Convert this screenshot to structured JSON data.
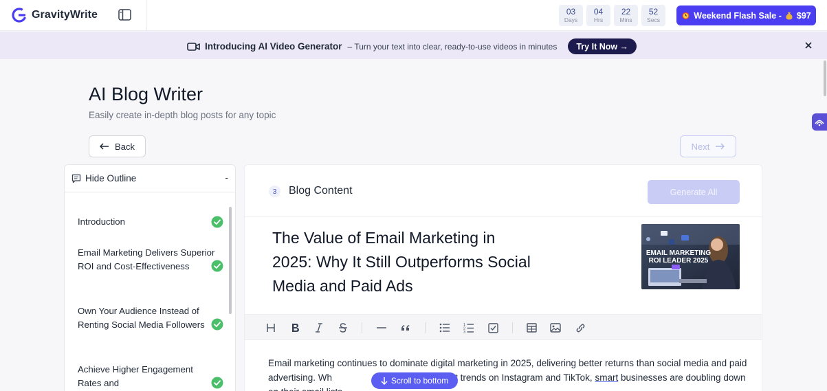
{
  "app": {
    "name": "GravityWrite"
  },
  "countdown": [
    {
      "value": "03",
      "unit": "Days"
    },
    {
      "value": "04",
      "unit": "Hrs"
    },
    {
      "value": "22",
      "unit": "Mins"
    },
    {
      "value": "52",
      "unit": "Secs"
    }
  ],
  "sale": {
    "label": "Weekend Flash Sale -",
    "price": "$97"
  },
  "announcement": {
    "title": "Introducing AI Video Generator",
    "subtitle": "– Turn your text into clear, ready-to-use videos in minutes",
    "cta": "Try It Now →"
  },
  "page": {
    "title": "AI Blog Writer",
    "subtitle": "Easily create in-depth blog posts for any topic",
    "back_label": "Back",
    "next_label": "Next"
  },
  "outline": {
    "header": "Hide Outline",
    "collapse_symbol": "-",
    "items": [
      {
        "label": "Introduction",
        "done": true
      },
      {
        "label": "Email Marketing Delivers Superior ROI and Cost-Effectiveness",
        "done": true
      },
      {
        "label": "Own Your Audience Instead of Renting Social Media Followers",
        "done": true
      },
      {
        "label": "Achieve Higher Engagement Rates and",
        "done": true
      }
    ]
  },
  "content": {
    "step_number": "3",
    "step_title": "Blog Content",
    "generate_label": "Generate All",
    "blog_title": "The Value of Email Marketing in 2025: Why It Still Outperforms Social Media and Paid Ads",
    "image_caption_line1": "EMAIL MARKETING",
    "image_caption_line2": "ROI LEADER 2025",
    "body_part1": "Email marketing continues to dominate digital marketing in 2025, delivering better returns than social media and paid advertising. Wh",
    "body_part2": "the latest trends on Instagram and TikTok,",
    "body_wavy": "smart",
    "body_part3": "businesses are doubling down on their email lists."
  },
  "scroll_button": "Scroll to bottom",
  "toolbar_icons": [
    "heading-icon",
    "bold-icon",
    "italic-icon",
    "strikethrough-icon",
    "horizontal-rule-icon",
    "quote-icon",
    "bullet-list-icon",
    "ordered-list-icon",
    "checklist-icon",
    "table-icon",
    "image-icon",
    "link-icon"
  ],
  "colors": {
    "accent": "#4a3df2",
    "banner_bg": "#ece8f8",
    "check": "#4cbf6b",
    "cta_dark": "#1d1a4d"
  }
}
